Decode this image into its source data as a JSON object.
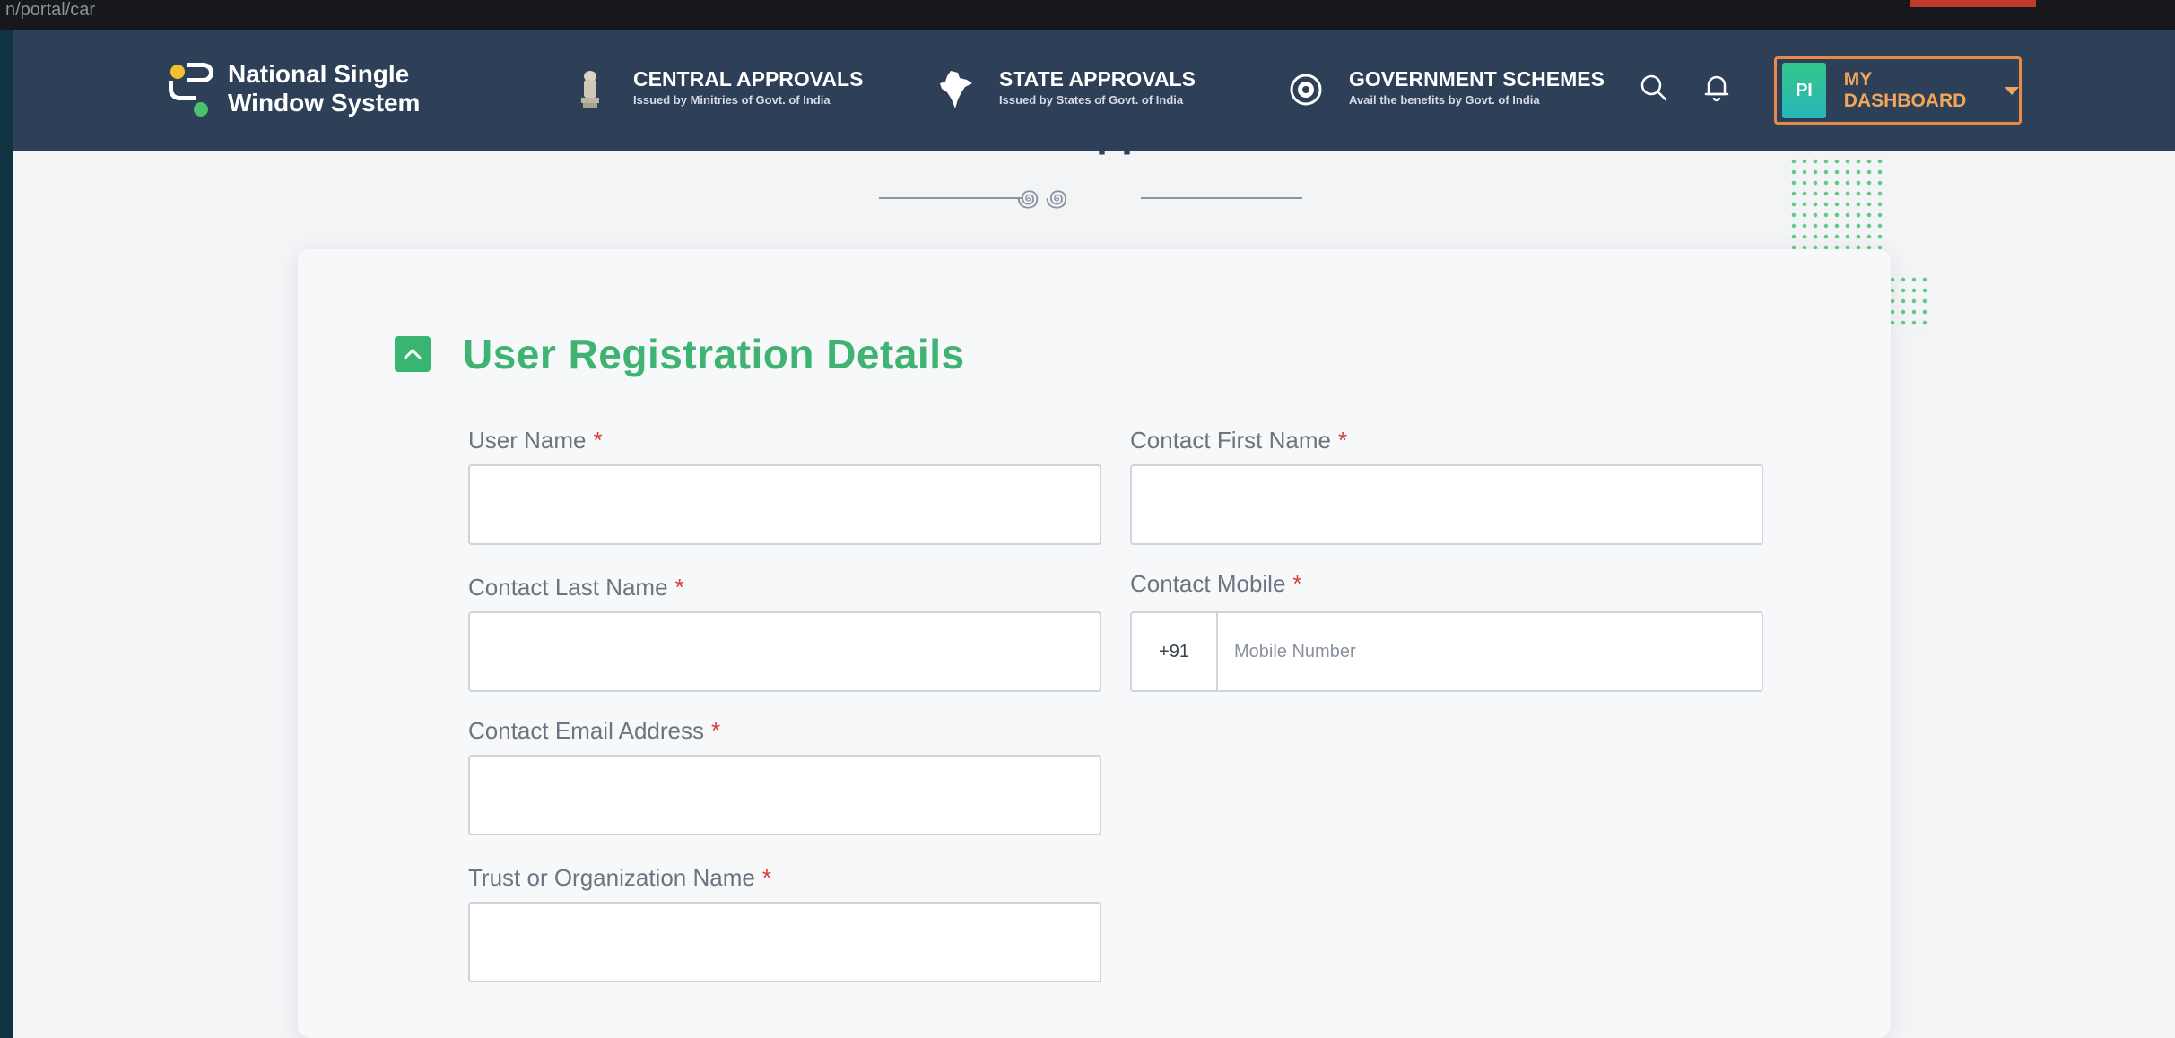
{
  "browser": {
    "url_fragment": "n/portal/car"
  },
  "header": {
    "logo_line1": "National Single",
    "logo_line2": "Window System",
    "nav": [
      {
        "title": "CENTRAL APPROVALS",
        "subtitle": "Issued by Minitries of Govt. of India",
        "icon": "emblem-icon"
      },
      {
        "title": "STATE APPROVALS",
        "subtitle": "Issued by States of Govt. of India",
        "icon": "india-map-icon"
      },
      {
        "title": "GOVERNMENT SCHEMES",
        "subtitle": "Avail the benefits by Govt. of India",
        "icon": "chakra-icon"
      }
    ],
    "search_icon": "search-icon",
    "bell_icon": "bell-icon",
    "dashboard": {
      "avatar_initials": "PI",
      "label": "MY DASHBOARD"
    }
  },
  "page": {
    "heading": "AICTE Approval",
    "section_title": "User Registration Details",
    "fields": {
      "user_name": {
        "label": "User Name",
        "required": "*",
        "value": ""
      },
      "contact_first_name": {
        "label": "Contact First Name",
        "required": "*",
        "value": ""
      },
      "contact_last_name": {
        "label": "Contact Last Name",
        "required": "*",
        "value": ""
      },
      "contact_mobile": {
        "label": "Contact Mobile",
        "required": "*",
        "prefix": "+91",
        "placeholder": "Mobile Number"
      },
      "contact_email": {
        "label": "Contact Email Address",
        "required": "*",
        "value": ""
      },
      "trust_name": {
        "label": "Trust or Organization Name",
        "required": "*",
        "value": ""
      }
    }
  },
  "colors": {
    "nav_bg": "#2e3f58",
    "accent_green": "#3fb371",
    "dashboard_orange": "#f2a65a",
    "required_red": "#d93b3b"
  }
}
